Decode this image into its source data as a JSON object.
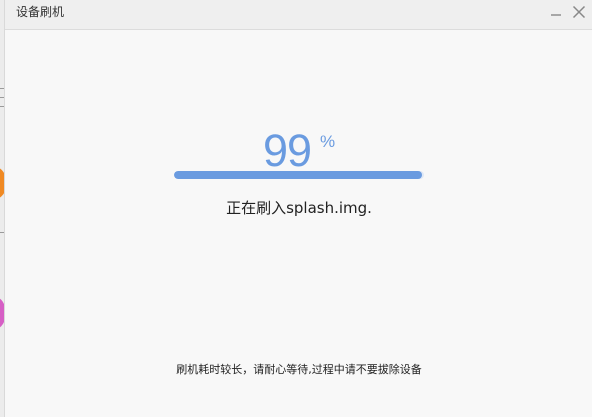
{
  "window": {
    "title": "设备刷机",
    "minimize_icon": "minimize-icon",
    "close_icon": "close-icon"
  },
  "progress": {
    "value": "99",
    "unit": "%",
    "fraction": 0.99,
    "status": "正在刷入splash.img."
  },
  "footer": {
    "notice": "刷机耗时较长，请耐心等待,过程中请不要拔除设备"
  },
  "colors": {
    "accent": "#6a9be0",
    "background": "#f8f8f8",
    "titlebar": "#efefef"
  }
}
